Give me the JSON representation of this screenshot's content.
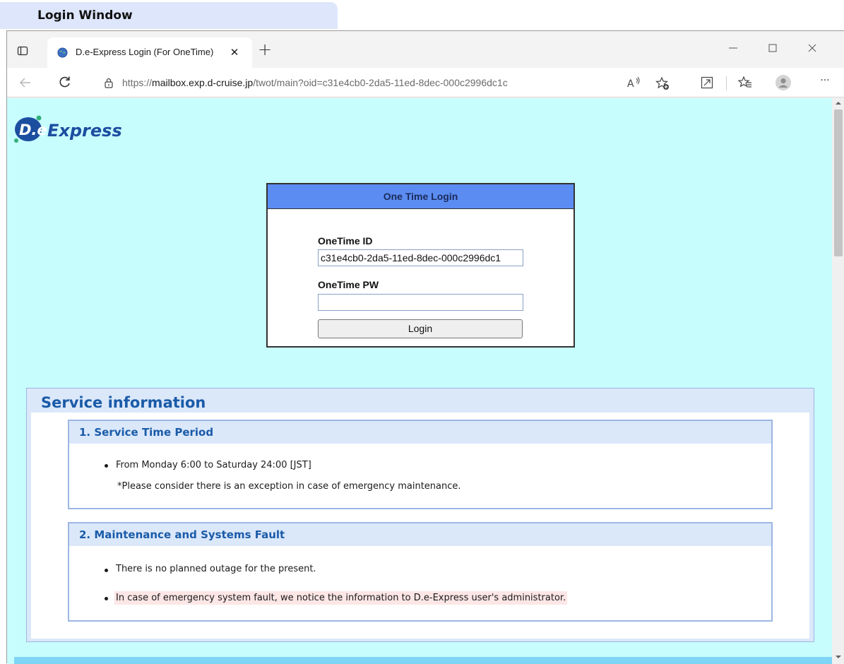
{
  "caption": {
    "label": "Login Window"
  },
  "browser": {
    "tab": {
      "title": "D.e-Express Login (For OneTime)",
      "close_glyph": "✕"
    },
    "new_tab_glyph": "+",
    "address": {
      "prefix": "https://",
      "host": "mailbox.exp.d-cruise.jp",
      "path": "/twot/main?oid=c31e4cb0-2da5-11ed-8dec-000c2996dc1c"
    },
    "toolbar_more_glyph": "···"
  },
  "logo": {
    "text": "Express",
    "mark": "D.e"
  },
  "login": {
    "header": "One Time Login",
    "id_label": "OneTime ID",
    "id_value": "c31e4cb0-2da5-11ed-8dec-000c2996dc1",
    "pw_label": "OneTime PW",
    "pw_value": "",
    "button_label": "Login"
  },
  "service": {
    "title": "Service information",
    "sections": [
      {
        "header": "1. Service Time Period",
        "items": [
          "From Monday 6:00 to Saturday 24:00 [JST]"
        ],
        "note": "*Please consider there is an exception in case of emergency maintenance."
      },
      {
        "header": "2. Maintenance and Systems Fault",
        "items": [
          "There is no planned outage for the present.",
          "In case of emergency system fault, we notice the information to D.e-Express user's administrator."
        ]
      }
    ]
  },
  "colors": {
    "page_background": "#c8fdfd",
    "login_header": "#5b8cf2",
    "section_header_text": "#1a5ba8",
    "highlight": "#fde6e6"
  }
}
